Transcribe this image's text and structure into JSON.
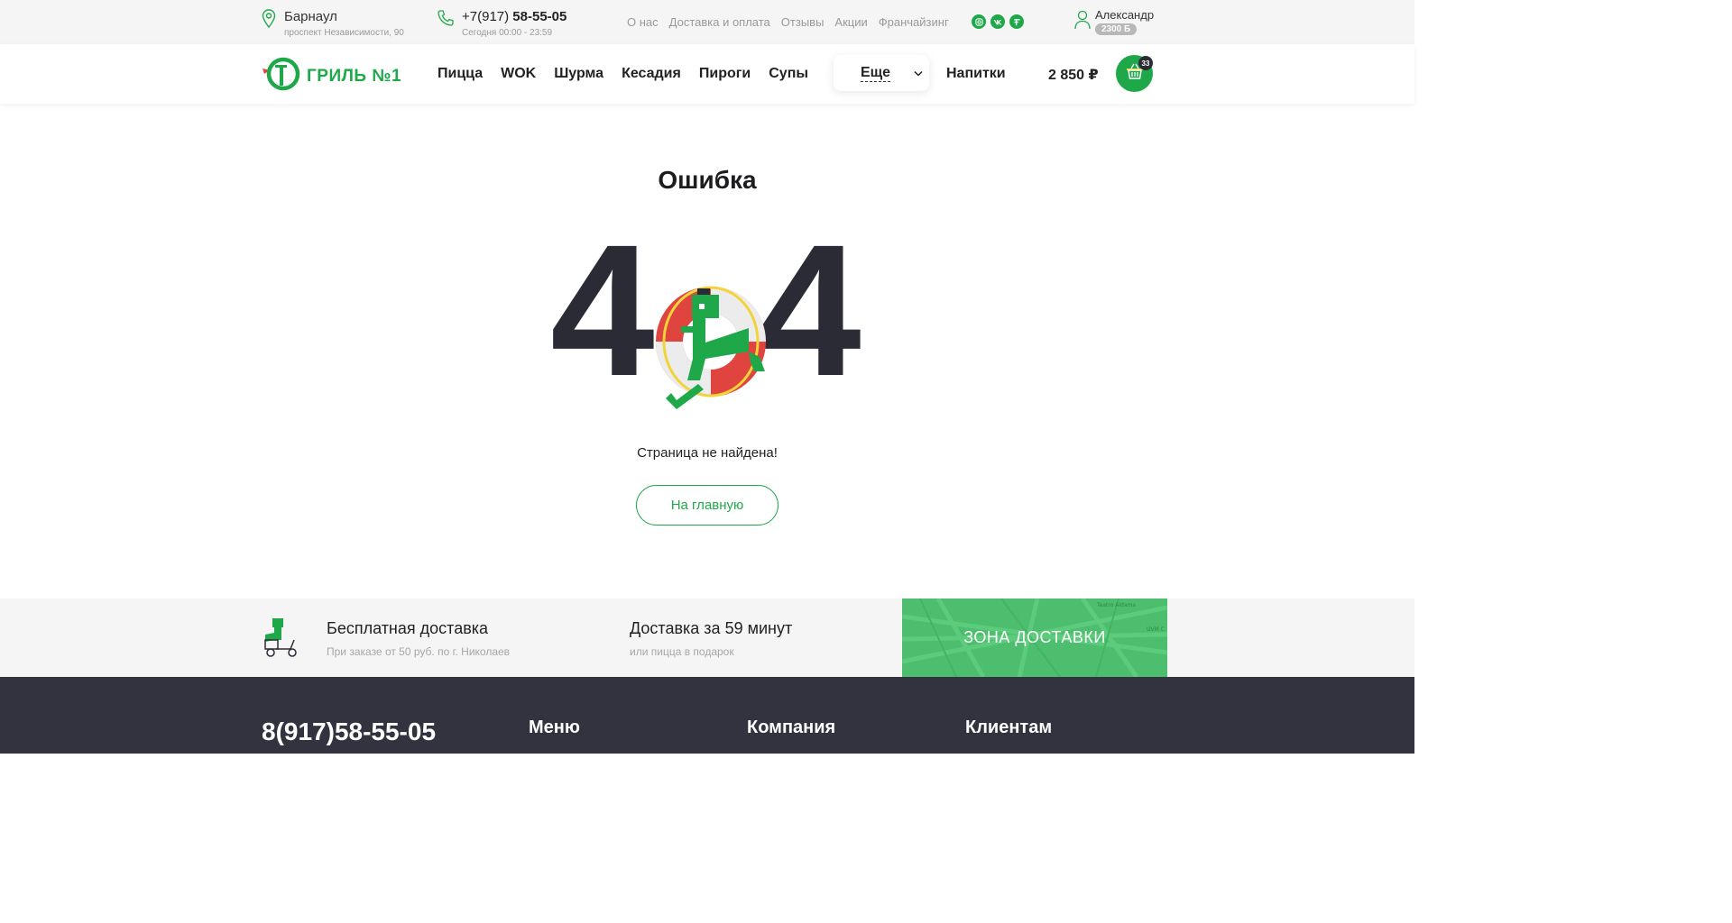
{
  "topbar": {
    "city": "Барнаул",
    "address": "проспект Независимости, 90",
    "phone_prefix": "+7(917)",
    "phone_main": "58-55-05",
    "hours": "Сегодня 00:00 - 23:59",
    "nav": [
      "О нас",
      "Доставка и оплата",
      "Отзывы",
      "Акции",
      "Франчайзинг"
    ],
    "socials": [
      "instagram-icon",
      "vk-icon",
      "other-social-icon"
    ],
    "user_name": "Александр",
    "user_bonus": "2300 Б"
  },
  "header": {
    "logo_text": "ГРИЛЬ №1",
    "nav": [
      "Пицца",
      "WOK",
      "Шурма",
      "Кесадия",
      "Пироги",
      "Супы"
    ],
    "more_label": "Еще",
    "drinks_label": "Напитки",
    "cart_total": "2 850 ₽",
    "cart_count": "33"
  },
  "error": {
    "title": "Ошибка",
    "code_left": "4",
    "code_right": "4",
    "message": "Страница не найдена!",
    "home_button": "На главную"
  },
  "info": {
    "free_delivery_title": "Бесплатная доставка",
    "free_delivery_sub": "При заказе от 50 руб. по г. Николаев",
    "fast_delivery_title": "Доставка за 59 минут",
    "fast_delivery_sub": "или пицца в подарок",
    "zone_label": "ЗОНА ДОСТАВКИ",
    "map_labels": [
      "Teatro Aldama",
      "UVM C"
    ]
  },
  "footer": {
    "phone": "8(917)58-55-05",
    "col_menu": "Меню",
    "col_company": "Компания",
    "col_clients": "Клиентам"
  },
  "colors": {
    "accent": "#1fa84a",
    "dark": "#333340",
    "red": "#e0443f"
  }
}
